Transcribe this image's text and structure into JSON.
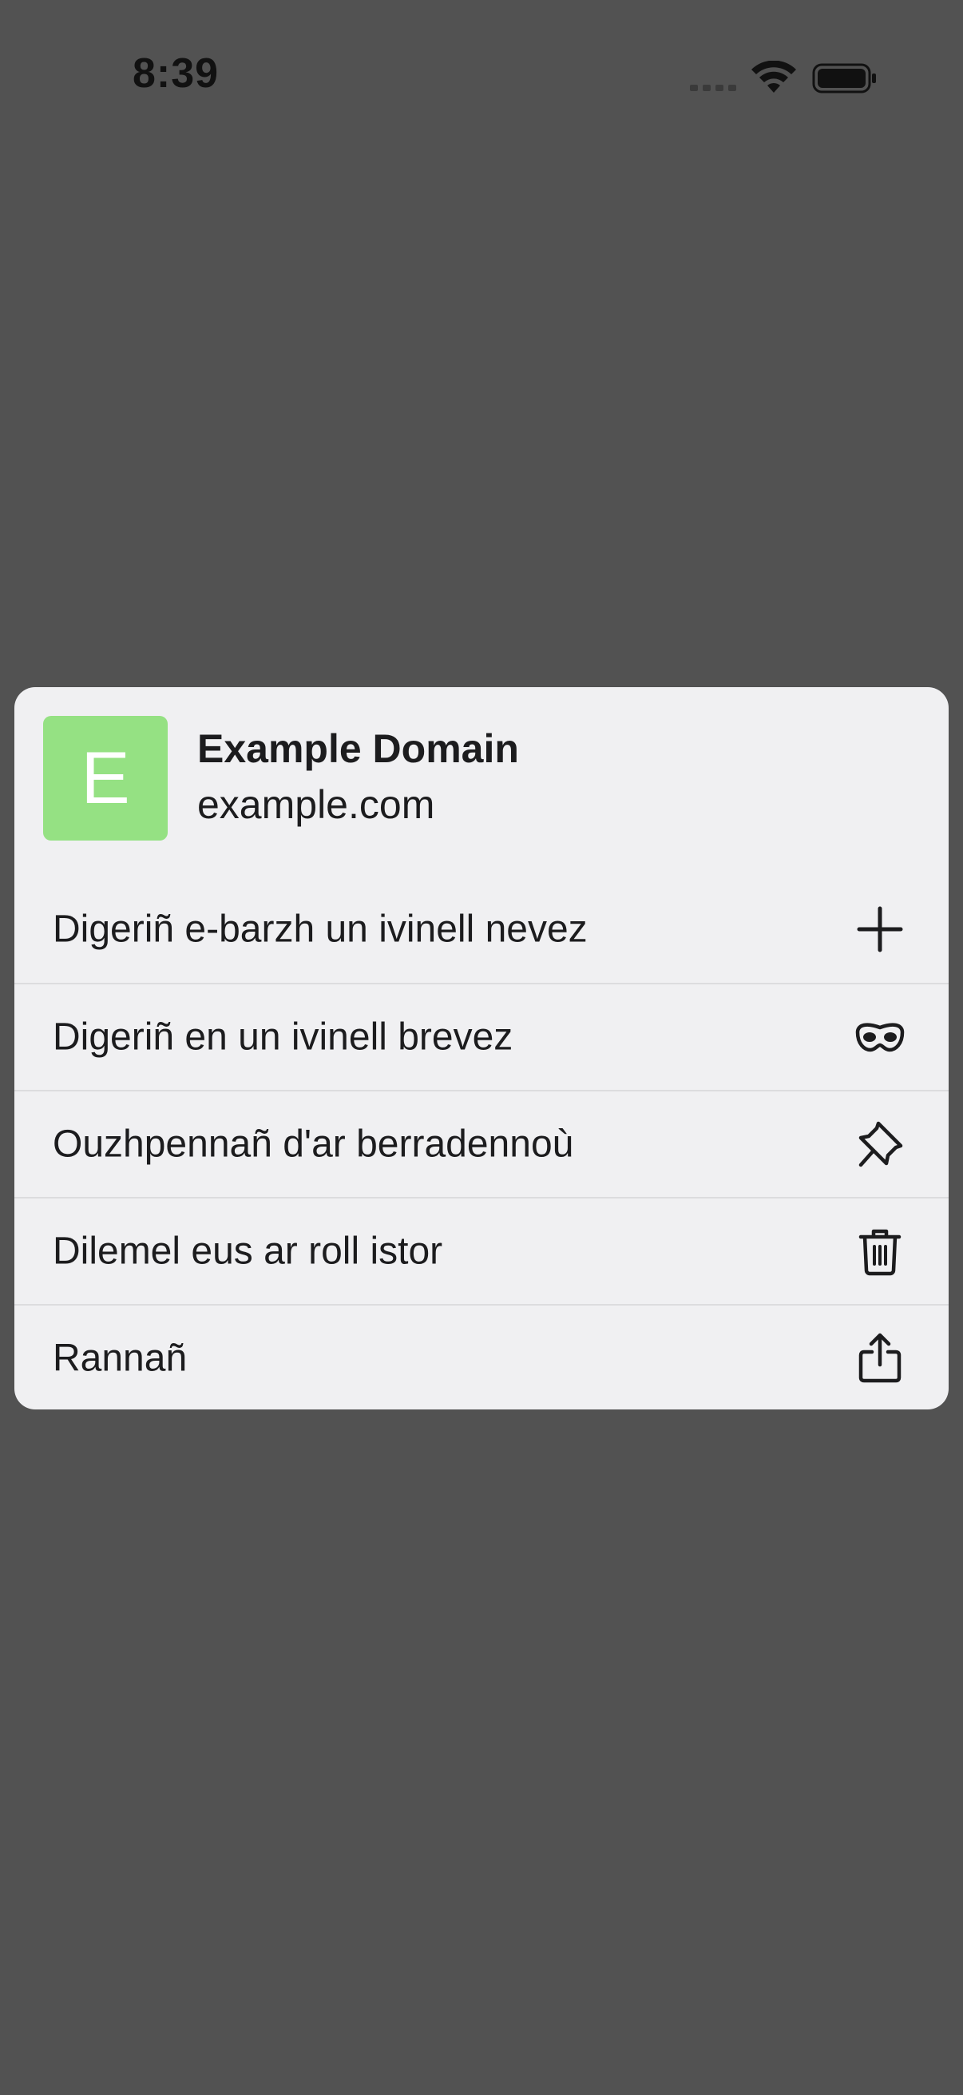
{
  "status_bar": {
    "time": "8:39",
    "icons": [
      "cellular-signal-icon",
      "wifi-icon",
      "battery-icon"
    ]
  },
  "preview": {
    "favicon_letter": "E",
    "favicon_color": "#95e183",
    "title": "Example Domain",
    "url": "example.com"
  },
  "menu": {
    "items": [
      {
        "label": "Digeriñ e-barzh un ivinell nevez",
        "icon": "plus-icon"
      },
      {
        "label": "Digeriñ en un ivinell brevez",
        "icon": "private-mask-icon"
      },
      {
        "label": "Ouzhpennañ d'ar berradennoù",
        "icon": "pin-icon"
      },
      {
        "label": "Dilemel eus ar roll istor",
        "icon": "trash-icon"
      },
      {
        "label": "Rannañ",
        "icon": "share-icon"
      }
    ]
  }
}
